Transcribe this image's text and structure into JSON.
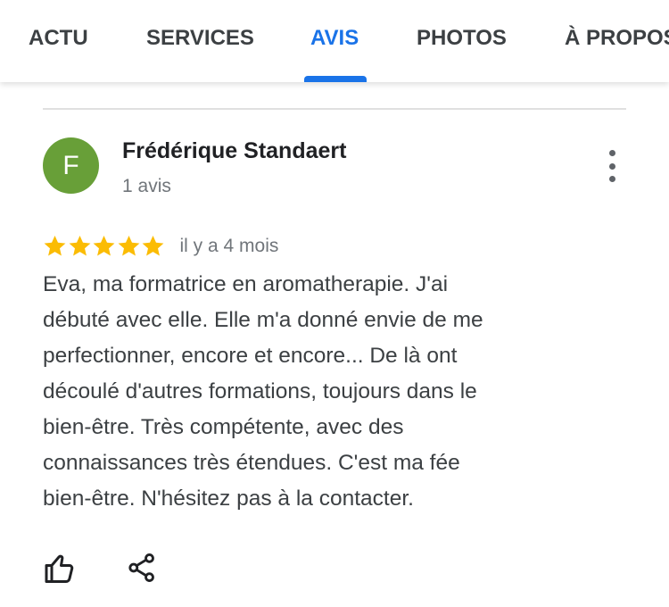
{
  "tabs": [
    {
      "label": "ACTU",
      "active": false
    },
    {
      "label": "SERVICES",
      "active": false
    },
    {
      "label": "AVIS",
      "active": true
    },
    {
      "label": "PHOTOS",
      "active": false
    },
    {
      "label": "À PROPOS",
      "active": false
    }
  ],
  "colors": {
    "accent": "#1a73e8",
    "avatar_bg": "#689f38",
    "star": "#fbbc04",
    "text": "#3c4043",
    "muted": "#70757a"
  },
  "review": {
    "avatar_letter": "F",
    "author": "Frédérique Standaert",
    "review_count": "1 avis",
    "rating": 5,
    "rating_max": 5,
    "date": "il y a 4 mois",
    "text_lines": [
      "Eva, ma formatrice en aromatherapie. J'ai",
      "débuté avec elle. Elle m'a donné envie de me",
      "perfectionner, encore et encore... De là ont",
      "découlé d'autres formations, toujours dans le",
      "bien-être. Très compétente, avec des",
      "connaissances très étendues. C'est ma fée",
      "bien-être. N'hésitez pas à la contacter."
    ],
    "more_icon": "more-vert-icon",
    "like_icon": "thumb-up-icon",
    "share_icon": "share-icon"
  }
}
